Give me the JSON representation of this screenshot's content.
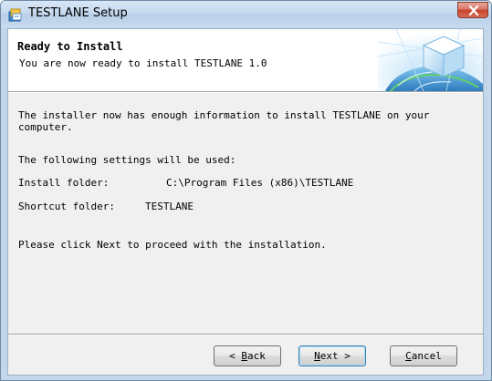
{
  "window": {
    "title": "TESTLANE Setup"
  },
  "header": {
    "title": "Ready to Install",
    "subtitle": "You are now ready to install TESTLANE 1.0"
  },
  "body": {
    "intro_line1": "The installer now has enough information to install TESTLANE on your",
    "intro_line2": "computer.",
    "settings_heading": "The following settings will be used:",
    "install_folder_label": "Install folder:",
    "install_folder_value": "C:\\Program Files (x86)\\TESTLANE",
    "shortcut_folder_label": "Shortcut folder:",
    "shortcut_folder_value": "TESTLANE",
    "proceed_text": "Please click Next to proceed with the installation."
  },
  "buttons": {
    "back": {
      "prefix": "< ",
      "mnemonic": "B",
      "rest": "ack"
    },
    "next": {
      "mnemonic": "N",
      "rest": "ext >"
    },
    "cancel": {
      "mnemonic": "C",
      "rest": "ancel"
    }
  },
  "colors": {
    "titlebar": "#c5d9ee",
    "close": "#c8422c",
    "dialog_bg": "#f0f0f0"
  }
}
